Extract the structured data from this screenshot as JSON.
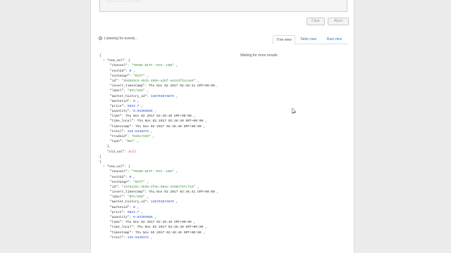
{
  "toolbar": {
    "clear_label": "Clear",
    "abort_label": "Abort"
  },
  "status": {
    "listening_text": "Listening for events..",
    "waiting_text": "Waiting for more results"
  },
  "tabs": [
    {
      "label": "Tree view",
      "active": true
    },
    {
      "label": "Table view",
      "active": false
    },
    {
      "label": "Raw view",
      "active": false
    }
  ],
  "events": [
    {
      "open_brace": "{",
      "new_val_key": "\"new_val\":",
      "new_val_open": "{",
      "fields": [
        {
          "key": "\"channel\":",
          "value": "\"TRADE-BITF--BTC--USD\"",
          "type": "s"
        },
        {
          "key": "\"exchId\":",
          "value": "0",
          "type": "n"
        },
        {
          "key": "\"exchange\":",
          "value": "\"BITF\"",
          "type": "s"
        },
        {
          "key": "\"id\":",
          "value": "\"d6d6d4c6-4531-40de-a3bf-e6343f31cae9\"",
          "type": "s"
        },
        {
          "key": "\"insert_timestamp\":",
          "value": "Thu Nov 02 2017 02:46:41 GMT+00:00",
          "type": "k"
        },
        {
          "key": "\"label\":",
          "value": "\"BTC/USD\"",
          "type": "s"
        },
        {
          "key": "\"market_history_id\":",
          "value": "135793874875",
          "type": "n"
        },
        {
          "key": "\"marketid\":",
          "value": "0",
          "type": "n"
        },
        {
          "key": "\"price\":",
          "value": "6824.7",
          "type": "n"
        },
        {
          "key": "\"quantity\":",
          "value": "0.03304685",
          "type": "n"
        },
        {
          "key": "\"time\":",
          "value": "Thu Nov 02 2017 02:46:40 GMT+00:00",
          "type": "k"
        },
        {
          "key": "\"time_local\":",
          "value": "Thu Nov 02 2017 02:46:40 GMT+00:00",
          "type": "k"
        },
        {
          "key": "\"timestamp\":",
          "value": "Thu Nov 02 2017 02:46:40 GMT+00:00",
          "type": "k"
        },
        {
          "key": "\"total\":",
          "value": "225.5348372",
          "type": "n"
        },
        {
          "key": "\"tradeid\":",
          "value": "\"83917339\"",
          "type": "s"
        },
        {
          "key": "\"type\":",
          "value": "\"BUY\"",
          "type": "s"
        }
      ],
      "new_val_close": "},",
      "old_val_key": "\"old_val\":",
      "old_val_value": "null",
      "close_brace": "}"
    },
    {
      "open_brace": "{",
      "new_val_key": "\"new_val\":",
      "new_val_open": "{",
      "fields": [
        {
          "key": "\"channel\":",
          "value": "\"TRADE-BITF--BTC--USD\"",
          "type": "s"
        },
        {
          "key": "\"exchId\":",
          "value": "0",
          "type": "n"
        },
        {
          "key": "\"exchange\":",
          "value": "\"BITF\"",
          "type": "s"
        },
        {
          "key": "\"id\":",
          "value": "\"e3762d3c-3bd9-4f5e-88ee-4700cf97cf18\"",
          "type": "s"
        },
        {
          "key": "\"insert_timestamp\":",
          "value": "Thu Nov 02 2017 02:46:41 GMT+00:00",
          "type": "k"
        },
        {
          "key": "\"label\":",
          "value": "\"BTC/USD\"",
          "type": "s"
        },
        {
          "key": "\"market_history_id\":",
          "value": "135793874875",
          "type": "n"
        },
        {
          "key": "\"marketid\":",
          "value": "0",
          "type": "n"
        },
        {
          "key": "\"price\":",
          "value": "6824.7",
          "type": "n"
        },
        {
          "key": "\"quantity\":",
          "value": "0.03304685",
          "type": "n"
        },
        {
          "key": "\"time\":",
          "value": "Thu Nov 02 2017 02:46:40 GMT+00:00",
          "type": "k"
        },
        {
          "key": "\"time_local\":",
          "value": "Thu Nov 02 2017 02:46:40 GMT+00:00",
          "type": "k"
        },
        {
          "key": "\"timestamp\":",
          "value": "Thu Nov 02 2017 02:46:40 GMT+00:00",
          "type": "k"
        },
        {
          "key": "\"total\":",
          "value": "225.5348372",
          "type": "n"
        }
      ]
    }
  ]
}
